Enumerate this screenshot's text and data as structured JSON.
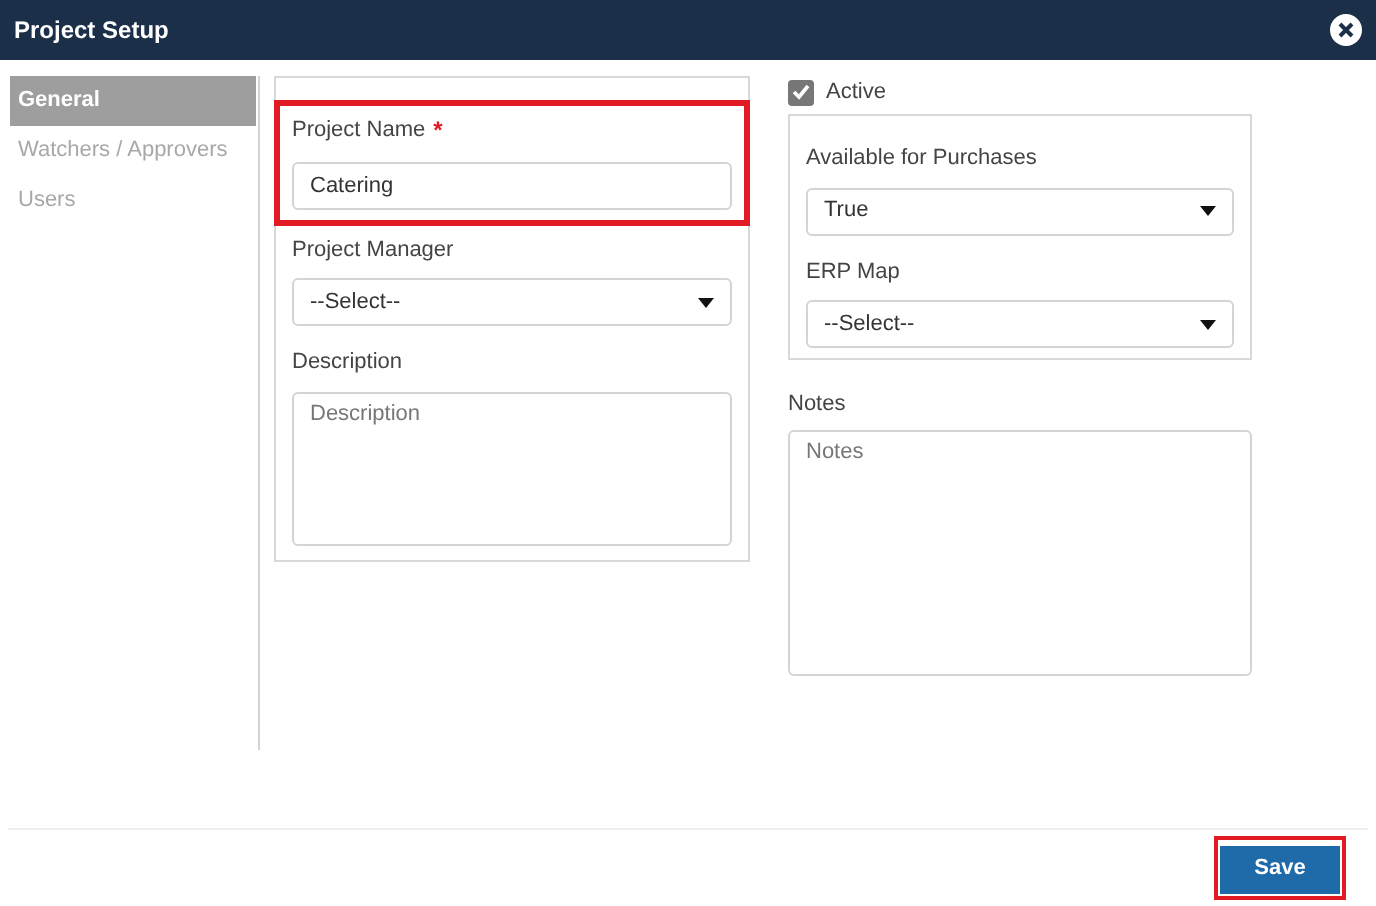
{
  "window": {
    "title": "Project Setup"
  },
  "sidebar": {
    "items": [
      {
        "label": "General",
        "selected": true
      },
      {
        "label": "Watchers / Approvers",
        "selected": false
      },
      {
        "label": "Users",
        "selected": false
      }
    ]
  },
  "left_panel": {
    "fields": [
      {
        "kind": "text",
        "label": "Project Name",
        "required_mark": "*",
        "value": "Catering",
        "highlighted": true
      },
      {
        "kind": "select",
        "label": "Project Manager",
        "value": "--Select--",
        "highlighted": false
      },
      {
        "kind": "textarea",
        "label": "Description",
        "placeholder": "Description",
        "highlighted": false
      }
    ]
  },
  "active": {
    "label": "Active",
    "checked": true
  },
  "right_panel": {
    "fields": [
      {
        "kind": "select",
        "label": "Available for Purchases",
        "value": "True"
      },
      {
        "kind": "select",
        "label": "ERP Map",
        "value": "--Select--"
      }
    ]
  },
  "notes": {
    "label": "Notes",
    "placeholder": "Notes"
  },
  "footer": {
    "save": {
      "label": "Save",
      "highlighted": true
    }
  }
}
